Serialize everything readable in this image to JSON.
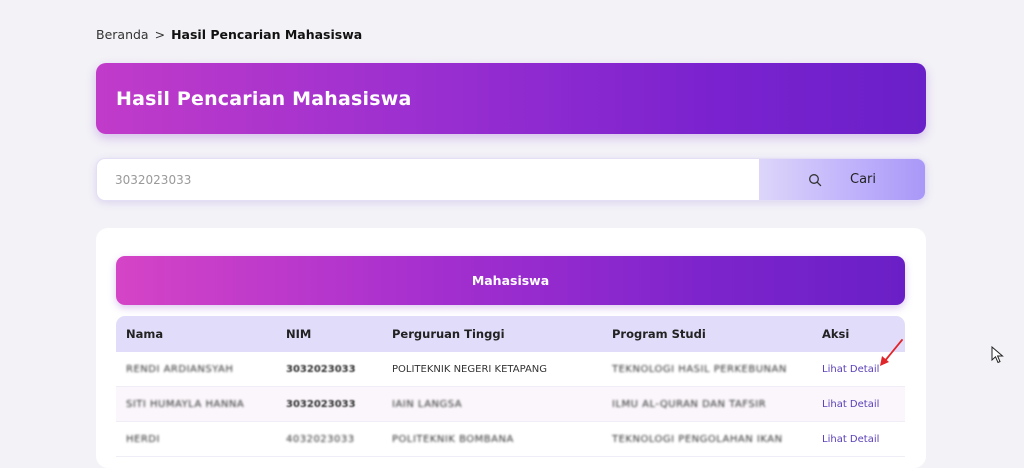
{
  "breadcrumb": {
    "home": "Beranda",
    "separator": ">",
    "current": "Hasil Pencarian Mahasiswa"
  },
  "banner": {
    "title": "Hasil Pencarian Mahasiswa"
  },
  "search": {
    "value": "3032023033",
    "button_label": "Cari",
    "button_icon": "search-icon"
  },
  "table": {
    "title": "Mahasiswa",
    "columns": [
      "Nama",
      "NIM",
      "Perguruan Tinggi",
      "Program Studi",
      "Aksi"
    ],
    "rows": [
      {
        "nama": "RENDI ARDIANSYAH",
        "nim": "3032023033",
        "pt": "POLITEKNIK NEGERI KETAPANG",
        "prodi": "TEKNOLOGI HASIL PERKEBUNAN",
        "aksi": "Lihat Detail"
      },
      {
        "nama": "SITI HUMAYLA HANNA",
        "nim": "3032023033",
        "pt": "IAIN LANGSA",
        "prodi": "ILMU AL-QURAN DAN TAFSIR",
        "aksi": "Lihat Detail"
      },
      {
        "nama": "HERDI",
        "nim": "4032023033",
        "pt": "POLITEKNIK BOMBANA",
        "prodi": "TEKNOLOGI PENGOLAHAN IKAN",
        "aksi": "Lihat Detail"
      }
    ]
  },
  "colors": {
    "accent": "#7a22cf",
    "annotation": "#e0262b",
    "link": "#5b3fb8"
  }
}
